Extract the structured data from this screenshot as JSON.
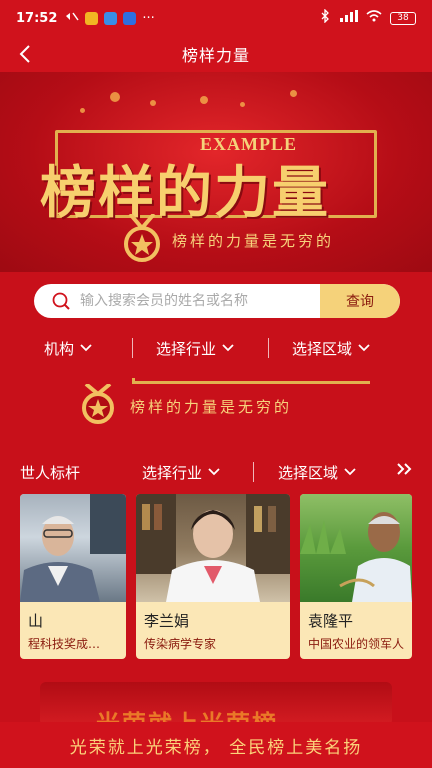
{
  "status_bar": {
    "time": "17:52",
    "battery": "38"
  },
  "nav": {
    "title": "榜样力量"
  },
  "banner": {
    "badge": "EXAMPLE",
    "title": "榜样的力量",
    "slogan": "榜样的力量是无穷的"
  },
  "search": {
    "placeholder": "输入搜索会员的姓名或名称",
    "button": "查询"
  },
  "filters": [
    {
      "label": "机构"
    },
    {
      "label": "选择行业"
    },
    {
      "label": "选择区域"
    }
  ],
  "strip": {
    "slogan": "榜样的力量是无穷的"
  },
  "filters2": [
    {
      "label": "世人标杆"
    },
    {
      "label": "选择行业"
    },
    {
      "label": "选择区域"
    }
  ],
  "cards": [
    {
      "name": "山",
      "desc": "程科技奖成…"
    },
    {
      "name": "李兰娟",
      "desc": "传染病学专家"
    },
    {
      "name": "袁隆平",
      "desc": "中国农业的领军人"
    }
  ],
  "bottom": {
    "ghost": "光荣就上光荣榜",
    "footer": "光荣就上光荣榜， 全民榜上美名扬"
  },
  "colors": {
    "primary_red": "#d0121c",
    "gold": "#f7cf6e",
    "card_bg": "#fbe7b6"
  }
}
